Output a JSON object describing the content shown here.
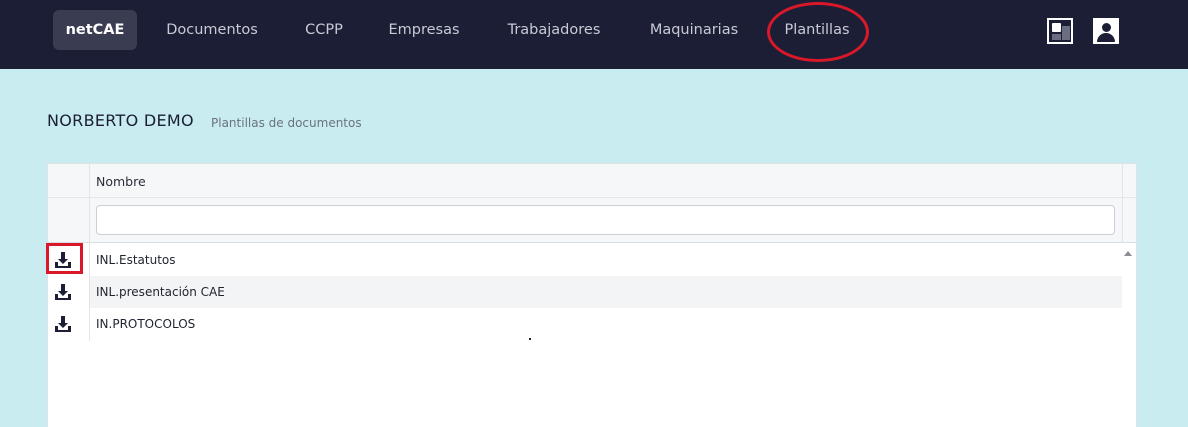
{
  "navbar": {
    "brand": "netCAE",
    "items": [
      {
        "label": "Documentos"
      },
      {
        "label": "CCPP"
      },
      {
        "label": "Empresas"
      },
      {
        "label": "Trabajadores"
      },
      {
        "label": "Maquinarias"
      },
      {
        "label": "Plantillas"
      }
    ],
    "icons": [
      "apps-icon",
      "user-icon"
    ]
  },
  "header": {
    "title": "NORBERTO DEMO",
    "subtitle": "Plantillas de documentos"
  },
  "table": {
    "column_header": "Nombre",
    "filter_value": "",
    "rows": [
      {
        "name": "INL.Estatutos",
        "icon": "download-icon"
      },
      {
        "name": "INL.presentación CAE",
        "icon": "download-icon"
      },
      {
        "name": "IN.PROTOCOLOS",
        "icon": "download-icon"
      }
    ]
  },
  "colors": {
    "navbar_bg": "#1b1e34",
    "page_bg": "#c9ecf0",
    "annotation_red": "#d9182a"
  }
}
